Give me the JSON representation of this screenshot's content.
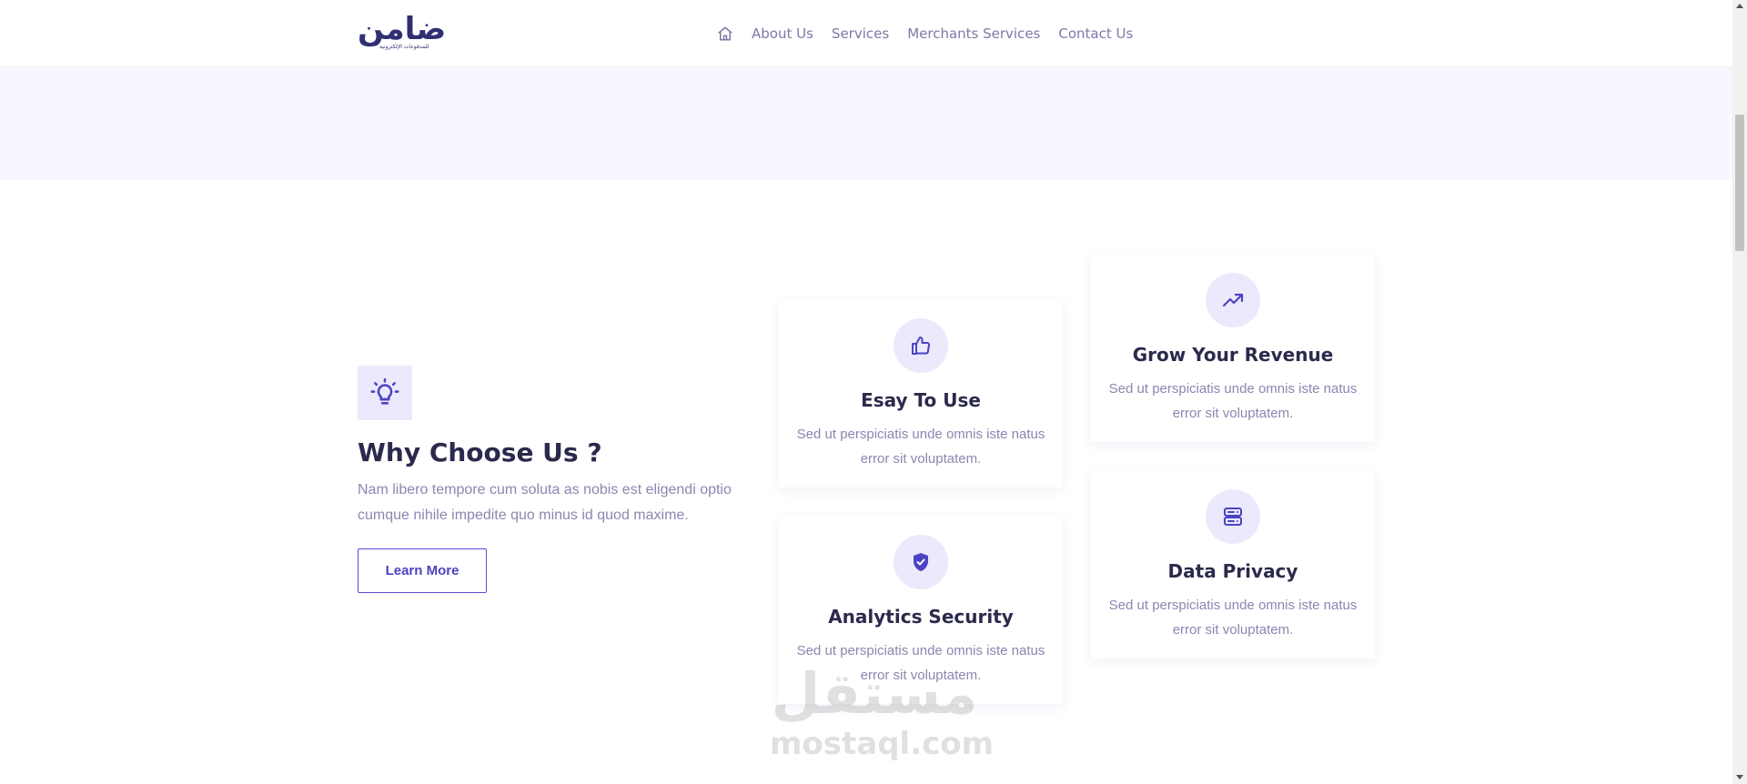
{
  "header": {
    "logo": {
      "wordmark": "ضامن",
      "tagline": "للمدفوعات الإلكترونية"
    },
    "nav": [
      {
        "label": "About Us"
      },
      {
        "label": "Services"
      },
      {
        "label": "Merchants Services"
      },
      {
        "label": "Contact Us"
      }
    ]
  },
  "why": {
    "title": "Why Choose Us ?",
    "description": "Nam libero tempore cum soluta as nobis est eligendi optio cumque nihile impedite quo minus id quod maxime.",
    "button": "Learn More"
  },
  "features": [
    {
      "icon": "thumbs-up-icon",
      "title": "Esay To Use",
      "text": "Sed ut perspiciatis unde omnis iste natus error sit voluptatem."
    },
    {
      "icon": "shield-check-icon",
      "title": "Analytics Security",
      "text": "Sed ut perspiciatis unde omnis iste natus error sit voluptatem."
    },
    {
      "icon": "trending-up-icon",
      "title": "Grow Your Revenue",
      "text": "Sed ut perspiciatis unde omnis iste natus error sit voluptatem."
    },
    {
      "icon": "server-icon",
      "title": "Data Privacy",
      "text": "Sed ut perspiciatis unde omnis iste natus error sit voluptatem."
    }
  ],
  "watermark": {
    "arabic": "مستقل",
    "latin": "mostaql.com"
  },
  "next_section_peek": "..."
}
